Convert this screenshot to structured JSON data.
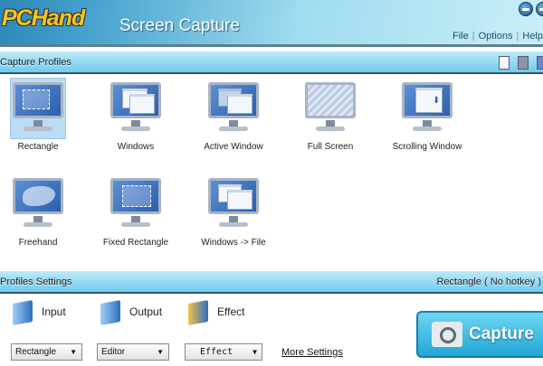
{
  "header": {
    "logo": "PCHand",
    "title": "Screen Capture",
    "menu": [
      "File",
      "Options",
      "Help"
    ]
  },
  "capture_profiles": {
    "title": "Capture Profiles",
    "profiles": [
      {
        "label": "Rectangle",
        "selected": true
      },
      {
        "label": "Windows"
      },
      {
        "label": "Active Window"
      },
      {
        "label": "Full Screen"
      },
      {
        "label": "Scrolling Window"
      },
      {
        "label": "Freehand"
      },
      {
        "label": "Fixed Rectangle"
      },
      {
        "label": "Windows -> File"
      }
    ]
  },
  "profiles_settings": {
    "title": "Profiles Settings",
    "status": "Rectangle ( No hotkey )",
    "input_label": "Input",
    "output_label": "Output",
    "effect_label": "Effect",
    "input_value": "Rectangle",
    "output_value": "Editor",
    "effect_value": "Effect",
    "more_settings": "More Settings",
    "capture_button": "Capture"
  }
}
